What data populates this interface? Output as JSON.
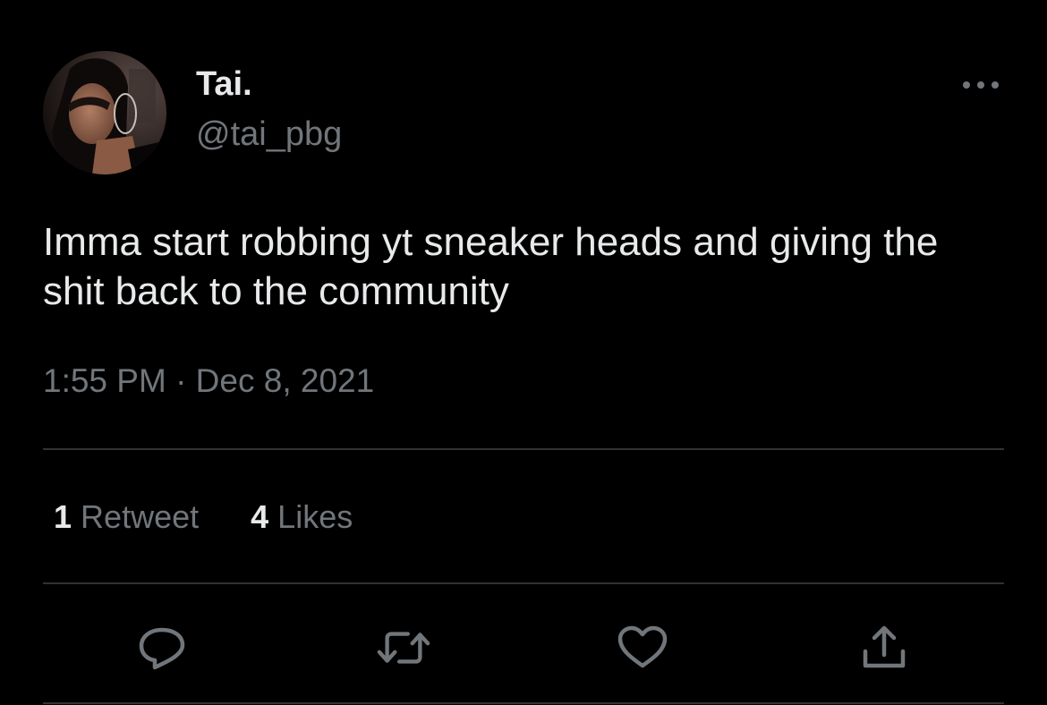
{
  "author": {
    "display_name": "Tai.",
    "handle": "@tai_pbg",
    "avatar_icon": "profile-photo"
  },
  "tweet": {
    "text": "Imma start robbing yt sneaker heads and giving the shit back to the community",
    "timestamp": "1:55 PM · Dec 8, 2021"
  },
  "stats": {
    "retweets_count": "1",
    "retweets_label": "Retweet",
    "likes_count": "4",
    "likes_label": "Likes"
  },
  "actions": [
    {
      "name": "reply",
      "icon": "reply-icon"
    },
    {
      "name": "retweet",
      "icon": "retweet-icon"
    },
    {
      "name": "like",
      "icon": "heart-icon"
    },
    {
      "name": "share",
      "icon": "share-icon"
    }
  ],
  "colors": {
    "background": "#000000",
    "primary_text": "#e7e9ea",
    "secondary_text": "#71767b",
    "divider": "#2f3336"
  }
}
